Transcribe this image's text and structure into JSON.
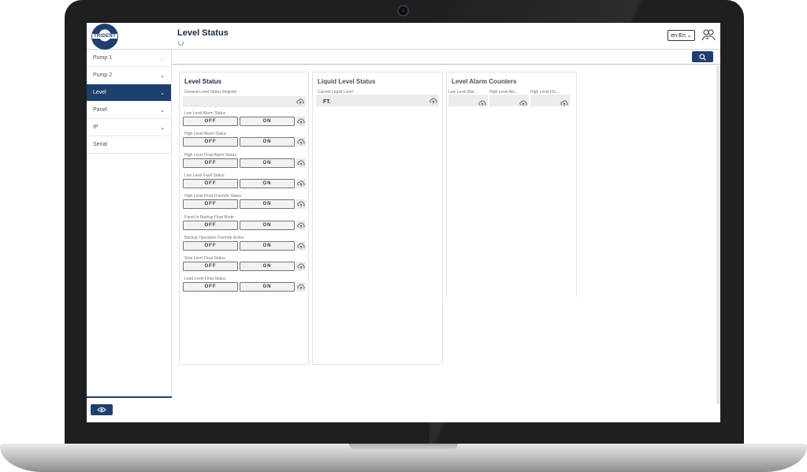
{
  "header": {
    "logo_text": "TRIDENT",
    "page_title": "Level Status",
    "language": "en-En",
    "language_caret": "⌄"
  },
  "sidebar": {
    "items": [
      {
        "label": "Pump 1",
        "chevron": "⌄"
      },
      {
        "label": "Pump 2",
        "chevron": "⌄"
      },
      {
        "label": "Level",
        "chevron": "⌄",
        "active": true
      },
      {
        "label": "Panel",
        "chevron": "⌄"
      },
      {
        "label": "IP",
        "chevron": "⌄"
      },
      {
        "label": "Serial",
        "chevron": ""
      }
    ]
  },
  "level_status": {
    "title": "Level Status",
    "register_label": "General Level Status Register",
    "off_label": "OFF",
    "on_label": "ON",
    "toggles": [
      "Low Level Alarm Status",
      "High Level Alarm Status",
      "High Level Float Alarm Status",
      "Low Level Fault Status",
      "High Level Float Override Status",
      "Panel In Backup Float Mode",
      "Backup Operation Override Active",
      "Stop Level Float Status",
      "Lead Level Float Status"
    ]
  },
  "liquid_level": {
    "title": "Liquid Level Status",
    "field_label": "Current Liquid Level",
    "value": "FT."
  },
  "alarm_counters": {
    "title": "Level Alarm Counters",
    "fields": [
      "Low Level Alar...",
      "High Level Ala...",
      "High Level Flo..."
    ]
  },
  "colors": {
    "brand": "#1f3f6e",
    "panel_bg": "#ececee"
  },
  "icons": {
    "user": "user-switch-icon",
    "search": "search-icon",
    "view": "eye-icon",
    "refresh": "cloud-refresh-icon"
  }
}
